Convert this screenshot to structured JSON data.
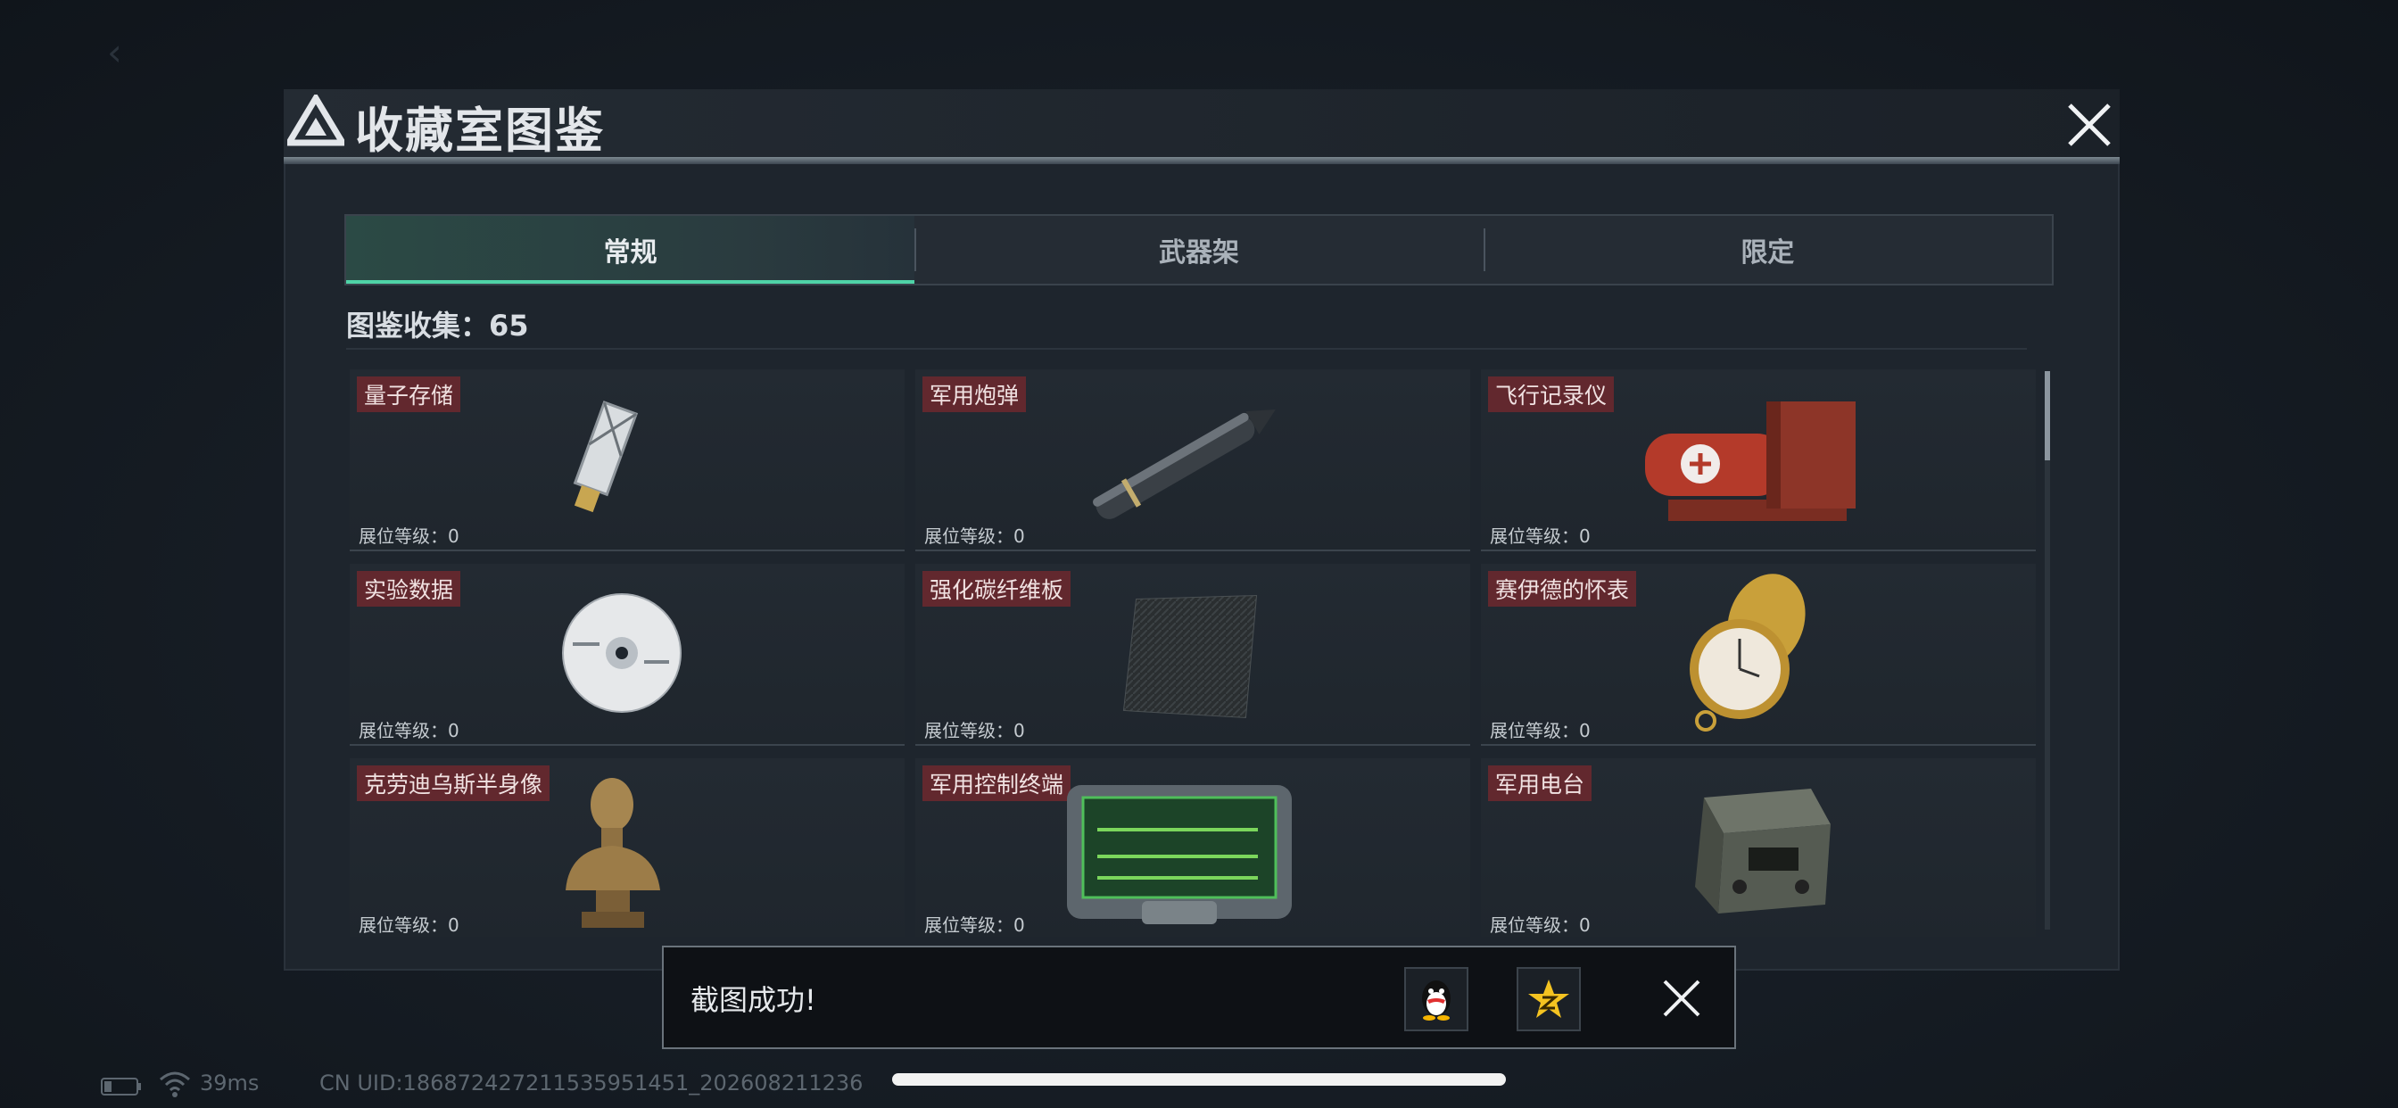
{
  "modal": {
    "title": "收藏室图鉴",
    "tabs": [
      "常规",
      "武器架",
      "限定"
    ],
    "active_tab": "常规",
    "collection_label": "图鉴收集：65"
  },
  "items": [
    {
      "name": "量子存储",
      "level_label": "展位等级：0"
    },
    {
      "name": "军用炮弹",
      "level_label": "展位等级：0"
    },
    {
      "name": "飞行记录仪",
      "level_label": "展位等级：0"
    },
    {
      "name": "实验数据",
      "level_label": "展位等级：0"
    },
    {
      "name": "强化碳纤维板",
      "level_label": "展位等级：0"
    },
    {
      "name": "赛伊德的怀表",
      "level_label": "展位等级：0"
    },
    {
      "name": "克劳迪乌斯半身像",
      "level_label": "展位等级：0"
    },
    {
      "name": "军用控制终端",
      "level_label": "展位等级：0"
    },
    {
      "name": "军用电台",
      "level_label": "展位等级：0"
    }
  ],
  "toast": {
    "message": "截图成功!",
    "share_icons": [
      "qq-penguin-icon",
      "qzone-star-icon"
    ]
  },
  "status": {
    "ping": "39ms",
    "uid": "CN UID:1868724272115359514​51_202608211236"
  },
  "colors": {
    "accent": "#4fd3a7",
    "tag_bg": "#782e34"
  }
}
